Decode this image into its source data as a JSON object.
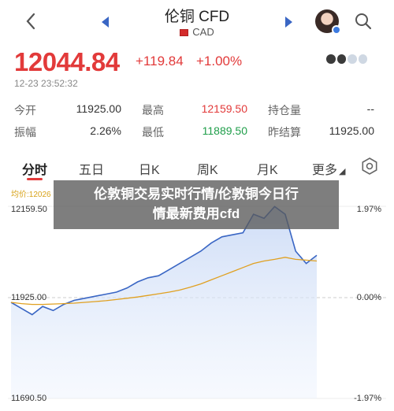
{
  "header": {
    "title": "伦铜 CFD",
    "subtitle": "CAD"
  },
  "quote": {
    "price": "12044.84",
    "change": "+119.84",
    "change_pct": "+1.00%",
    "timestamp": "12-23 23:52:32"
  },
  "stats": [
    [
      {
        "label": "今开",
        "value": "11925.00",
        "tone": "plain"
      },
      {
        "label": "最高",
        "value": "12159.50",
        "tone": "red"
      },
      {
        "label": "持仓量",
        "value": "--",
        "tone": "plain"
      }
    ],
    [
      {
        "label": "振幅",
        "value": "2.26%",
        "tone": "plain"
      },
      {
        "label": "最低",
        "value": "11889.50",
        "tone": "green"
      },
      {
        "label": "昨结算",
        "value": "11925.00",
        "tone": "plain"
      }
    ]
  ],
  "tabs": [
    "分时",
    "五日",
    "日K",
    "周K",
    "月K",
    "更多"
  ],
  "chart": {
    "avg_label": "均价:12026",
    "y_top": "12159.50",
    "y_mid": "11925.00",
    "y_bottom": "11690.50",
    "pct_top": "1.97%",
    "pct_mid": "0.00%",
    "pct_bottom": "-1.97%"
  },
  "banner": {
    "line1": "伦敦铜交易实时行情/伦敦铜今日行",
    "line2": "情最新费用cfd"
  },
  "colors": {
    "up": "#e23a3a",
    "down": "#1f9e4a",
    "line": "#3a66c4",
    "avg": "#e0a020"
  },
  "chart_data": {
    "type": "line",
    "ylim": [
      11690.5,
      12159.5
    ],
    "series": [
      {
        "values": [
          11925,
          11910,
          11895,
          11915,
          11905,
          11920,
          11930,
          11935,
          11940,
          11945,
          11950,
          11960,
          11975,
          11985,
          11990,
          12005,
          12020,
          12035,
          12050,
          12070,
          12085,
          12090,
          12095,
          12140,
          12130,
          12159,
          12140,
          12050,
          12020,
          12040
        ]
      },
      {
        "values": [
          11925,
          11922,
          11920,
          11920,
          11921,
          11922,
          11923,
          11925,
          11927,
          11929,
          11932,
          11935,
          11938,
          11942,
          11946,
          11950,
          11955,
          11962,
          11970,
          11980,
          11990,
          12000,
          12010,
          12020,
          12026,
          12030,
          12035,
          12030,
          12028,
          12026
        ]
      }
    ]
  }
}
